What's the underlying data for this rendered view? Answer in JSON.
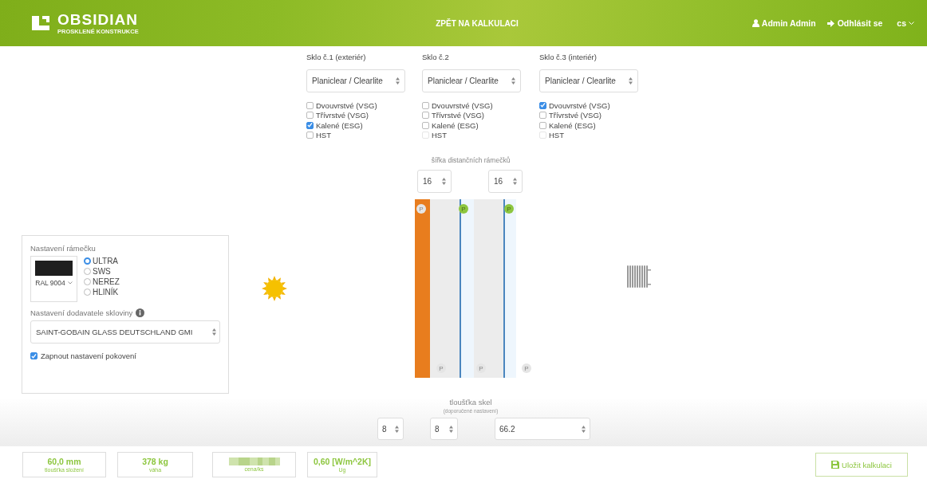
{
  "header": {
    "logo_text": "OBSIDIAN",
    "logo_subtitle": "PROSKLENÉ KONSTRUKCE",
    "back_link": "ZPĚT NA KALKULACI",
    "user": "Admin Admin",
    "logout": "Odhlásit se",
    "language": "cs"
  },
  "glasses": [
    {
      "title": "Sklo č.1 (exteriér)",
      "type": "Planiclear / Clearlite",
      "options": [
        {
          "label": "Dvouvrstvé (VSG)",
          "checked": false,
          "disabled": false
        },
        {
          "label": "Třívrstvé (VSG)",
          "checked": false,
          "disabled": false
        },
        {
          "label": "Kalené (ESG)",
          "checked": true,
          "disabled": false
        },
        {
          "label": "HST",
          "checked": false,
          "disabled": false
        }
      ]
    },
    {
      "title": "Sklo č.2",
      "type": "Planiclear / Clearlite",
      "options": [
        {
          "label": "Dvouvrstvé (VSG)",
          "checked": false,
          "disabled": false
        },
        {
          "label": "Třívrstvé (VSG)",
          "checked": false,
          "disabled": false
        },
        {
          "label": "Kalené (ESG)",
          "checked": false,
          "disabled": false
        },
        {
          "label": "HST",
          "checked": false,
          "disabled": true
        }
      ]
    },
    {
      "title": "Sklo č.3 (interiér)",
      "type": "Planiclear / Clearlite",
      "options": [
        {
          "label": "Dvouvrstvé (VSG)",
          "checked": true,
          "disabled": false
        },
        {
          "label": "Třívrstvé (VSG)",
          "checked": false,
          "disabled": false
        },
        {
          "label": "Kalené (ESG)",
          "checked": false,
          "disabled": false
        },
        {
          "label": "HST",
          "checked": false,
          "disabled": true
        }
      ]
    }
  ],
  "spacer": {
    "label": "šířka distančních rámečků",
    "widths": [
      "16",
      "16"
    ]
  },
  "diagram": {
    "markers": [
      {
        "label": "P",
        "highlighted": false
      },
      {
        "label": "P",
        "highlighted": false
      },
      {
        "label": "P",
        "highlighted": true
      },
      {
        "label": "P",
        "highlighted": false
      },
      {
        "label": "P",
        "highlighted": true
      },
      {
        "label": "P",
        "highlighted": false
      }
    ]
  },
  "frame_settings": {
    "title": "Nastavení rámečku",
    "color_label": "RAL 9004",
    "frame_types": [
      {
        "label": "ULTRA",
        "selected": true
      },
      {
        "label": "SWS",
        "selected": false
      },
      {
        "label": "NEREZ",
        "selected": false
      },
      {
        "label": "HLINÍK",
        "selected": false
      }
    ],
    "supplier_title": "Nastavení dodavatele skloviny",
    "supplier": "SAINT-GOBAIN GLASS DEUTSCHLAND GMI",
    "coating_label": "Zapnout nastavení pokovení",
    "coating_checked": true
  },
  "thickness": {
    "label": "tloušťka skel",
    "note": "(doporučené nastavení)",
    "values": [
      "8",
      "8",
      "66.2"
    ]
  },
  "summary": [
    {
      "value": "60,0 mm",
      "label": "tloušťka složení"
    },
    {
      "value": "378 kg",
      "label": "váha"
    },
    {
      "label": "cena/ks"
    },
    {
      "value": "0,60 [W/m^2K]",
      "label": "Ug"
    }
  ],
  "save_button": "Uložit kalkulaci"
}
